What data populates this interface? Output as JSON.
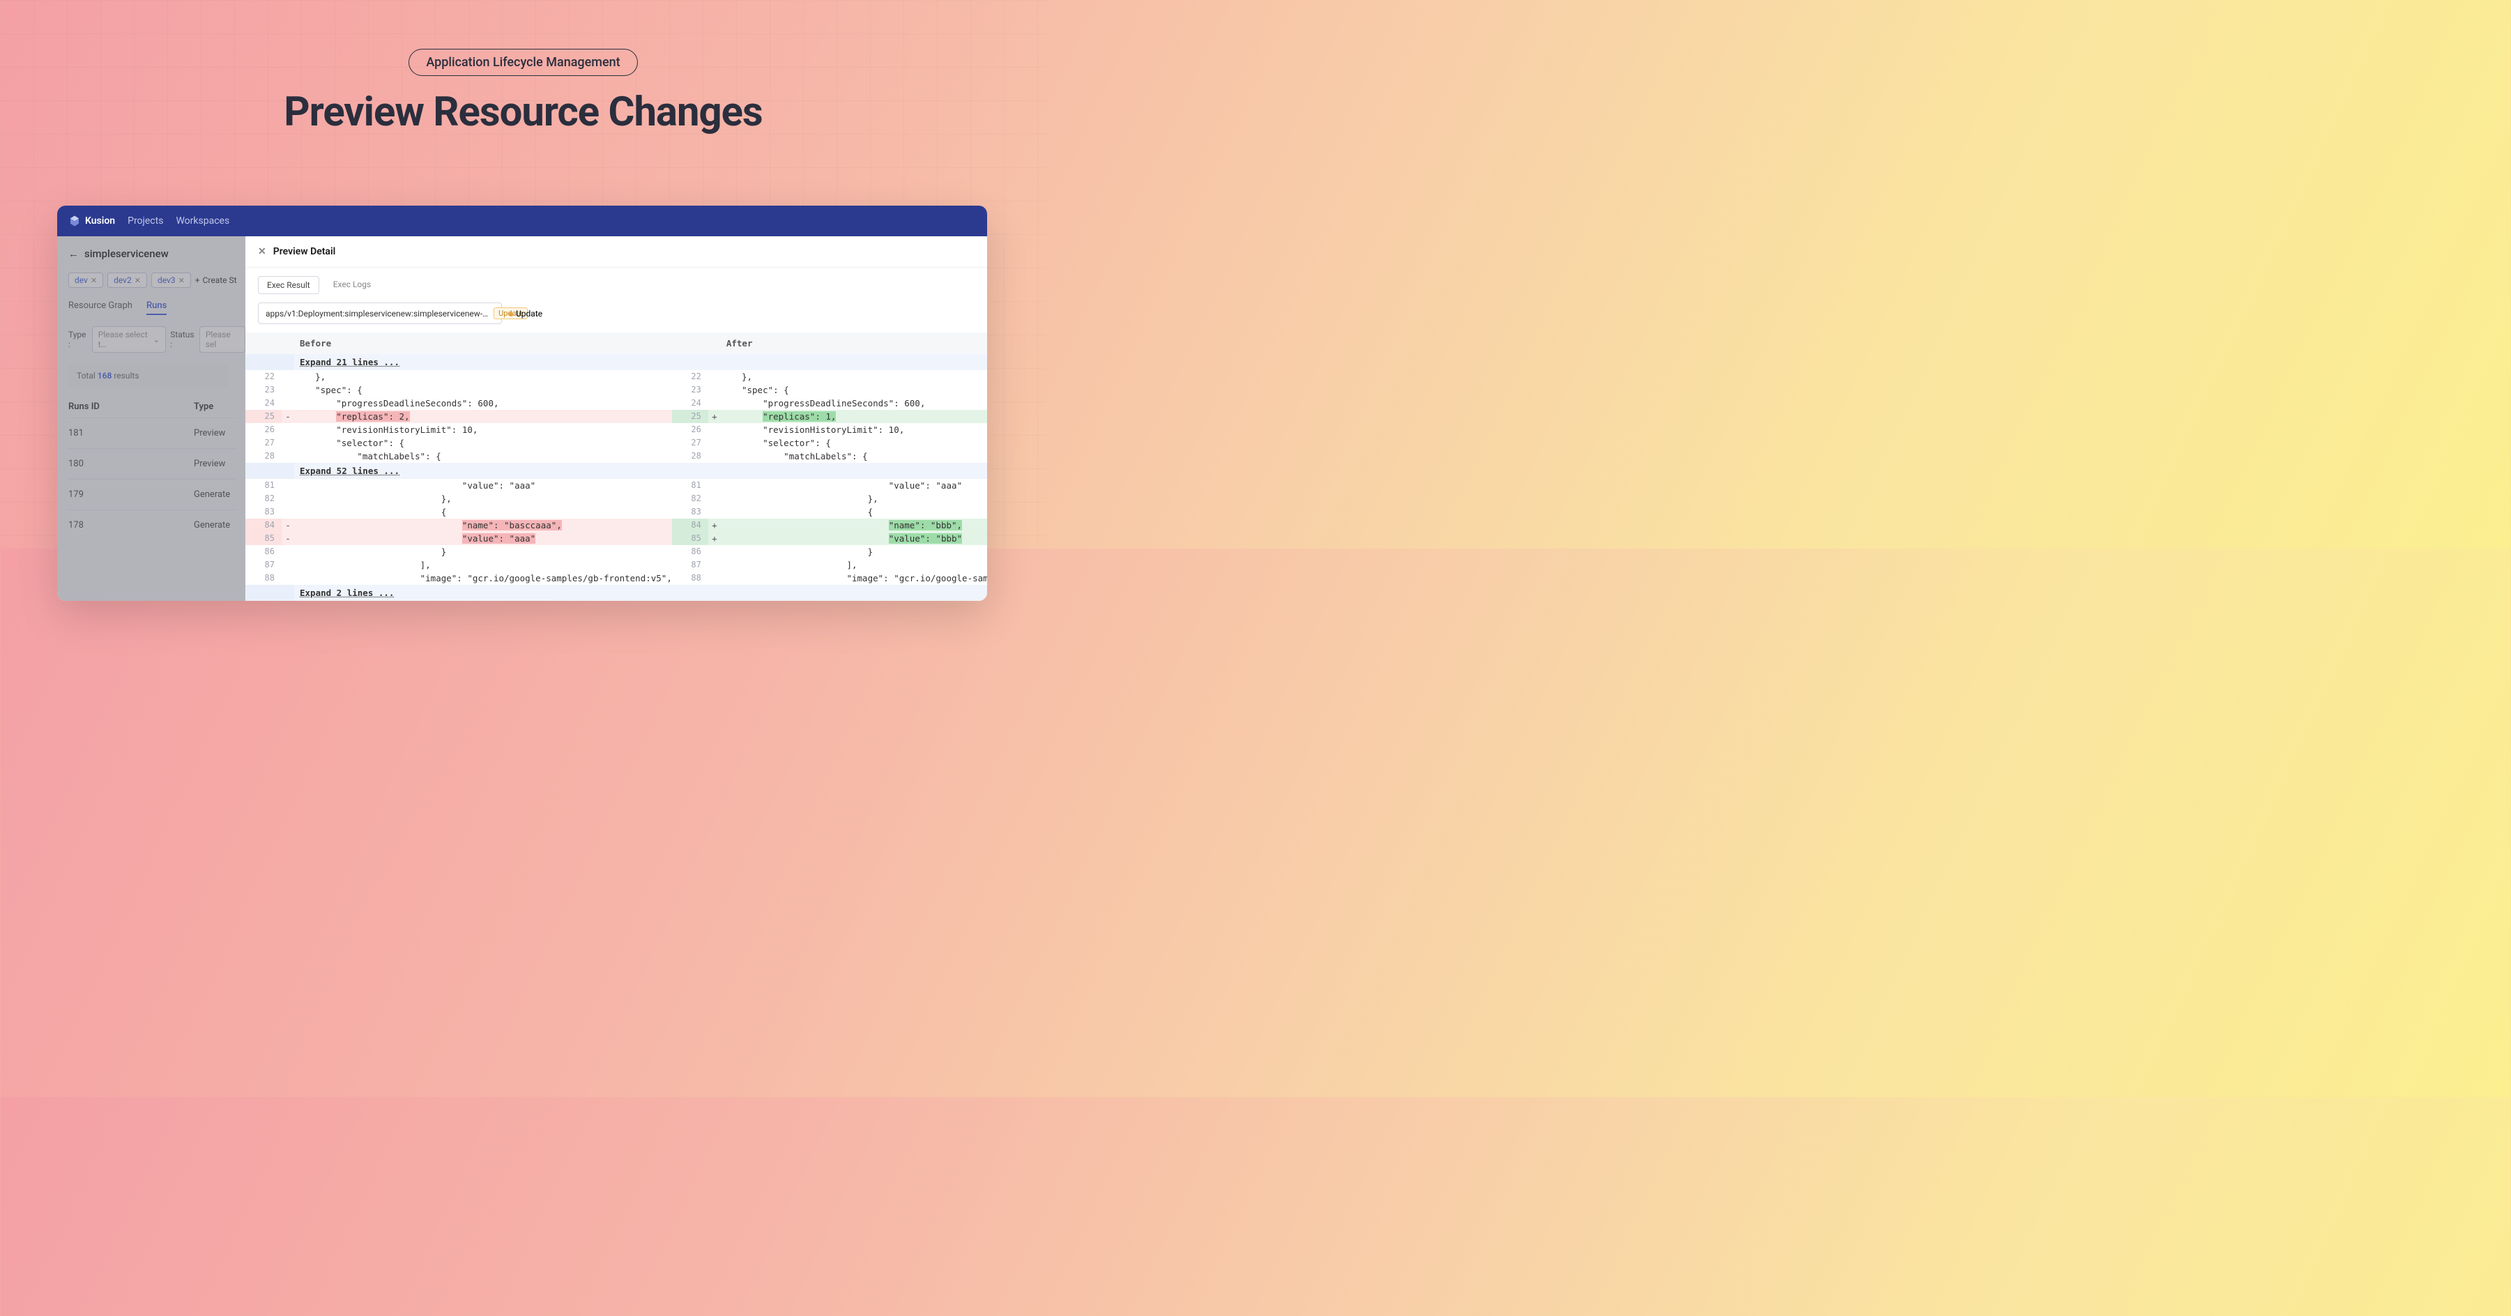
{
  "hero": {
    "pill": "Application Lifecycle Management",
    "title": "Preview Resource Changes"
  },
  "nav": {
    "brand": "Kusion",
    "links": [
      "Projects",
      "Workspaces"
    ]
  },
  "sidebar": {
    "back_label": "simpleservicenew",
    "stacks": [
      "dev",
      "dev2",
      "dev3"
    ],
    "create_stack": "Create St",
    "subtabs": {
      "graph": "Resource Graph",
      "runs": "Runs"
    },
    "filters": {
      "type_label": "Type :",
      "type_placeholder": "Please select t…",
      "status_label": "Status :",
      "status_placeholder": "Please sel"
    },
    "total": {
      "prefix": "Total",
      "count": "168",
      "suffix": "results"
    },
    "columns": {
      "id": "Runs ID",
      "type": "Type"
    },
    "rows": [
      {
        "id": "181",
        "type": "Preview"
      },
      {
        "id": "180",
        "type": "Preview"
      },
      {
        "id": "179",
        "type": "Generate"
      },
      {
        "id": "178",
        "type": "Generate"
      }
    ]
  },
  "panel": {
    "title": "Preview Detail",
    "exec_tabs": {
      "result": "Exec Result",
      "logs": "Exec Logs"
    },
    "resource": {
      "path": "apps/v1:Deployment:simpleservicenew:simpleservicenew-…",
      "badge": "Update",
      "status": "Update"
    },
    "diff": {
      "before_label": "Before",
      "after_label": "After",
      "expand_1": "Expand 21 lines ...",
      "expand_2": "Expand 52 lines ...",
      "expand_3": "Expand 2 lines ...",
      "block1": {
        "lines": [
          {
            "n": "22",
            "t": "    },",
            "type": "ctx"
          },
          {
            "n": "23",
            "t": "    \"spec\": {",
            "type": "ctx"
          },
          {
            "n": "24",
            "t": "        \"progressDeadlineSeconds\": 600,",
            "type": "ctx"
          },
          {
            "n": "25",
            "t_before": "        \"replicas\": 2,",
            "t_after": "        \"replicas\": 1,",
            "type": "change",
            "hl_before": "\"replicas\": 2,",
            "hl_after": "\"replicas\": 1,"
          },
          {
            "n": "26",
            "t": "        \"revisionHistoryLimit\": 10,",
            "type": "ctx"
          },
          {
            "n": "27",
            "t": "        \"selector\": {",
            "type": "ctx"
          },
          {
            "n": "28",
            "t": "            \"matchLabels\": {",
            "type": "ctx"
          }
        ]
      },
      "block2": {
        "lines": [
          {
            "n": "81",
            "t": "                                \"value\": \"aaa\"",
            "type": "ctx"
          },
          {
            "n": "82",
            "t": "                            },",
            "type": "ctx"
          },
          {
            "n": "83",
            "t": "                            {",
            "type": "ctx"
          },
          {
            "n": "84",
            "t_before": "                                \"name\": \"basccaaa\",",
            "t_after": "                                \"name\": \"bbb\",",
            "type": "change",
            "hl_before": "\"name\": \"basccaaa\",",
            "hl_after": "\"name\": \"bbb\","
          },
          {
            "n": "85",
            "t_before": "                                \"value\": \"aaa\"",
            "t_after": "                                \"value\": \"bbb\"",
            "type": "change",
            "hl_before": "\"value\": \"aaa\"",
            "hl_after": "\"value\": \"bbb\""
          },
          {
            "n": "86",
            "t": "                            }",
            "type": "ctx"
          },
          {
            "n": "87",
            "t": "                        ],",
            "type": "ctx"
          },
          {
            "n": "88",
            "t": "                        \"image\": \"gcr.io/google-samples/gb-frontend:v5\",",
            "type": "ctx"
          }
        ]
      }
    }
  }
}
